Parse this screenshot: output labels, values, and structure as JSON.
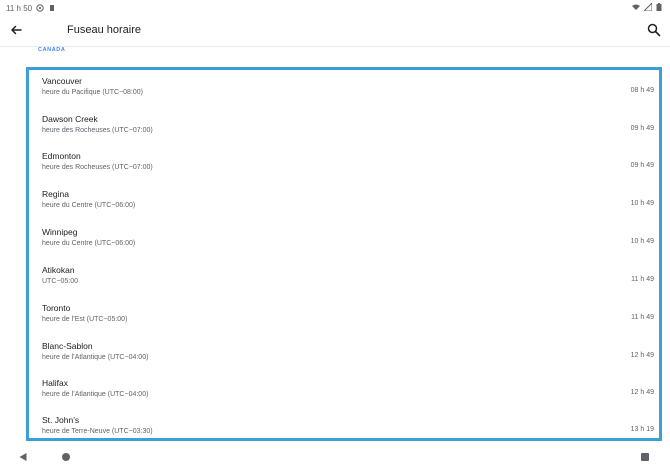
{
  "status": {
    "time": "11 h 50"
  },
  "appbar": {
    "title": "Fuseau horaire"
  },
  "section": "CANADA",
  "rows": [
    {
      "city": "Vancouver",
      "zone": "heure du Pacifique (UTC−08:00)",
      "time": "08 h 49"
    },
    {
      "city": "Dawson Creek",
      "zone": "heure des Rocheuses (UTC−07:00)",
      "time": "09 h 49"
    },
    {
      "city": "Edmonton",
      "zone": "heure des Rocheuses (UTC−07:00)",
      "time": "09 h 49"
    },
    {
      "city": "Regina",
      "zone": "heure du Centre (UTC−06:00)",
      "time": "10 h 49"
    },
    {
      "city": "Winnipeg",
      "zone": "heure du Centre (UTC−06:00)",
      "time": "10 h 49"
    },
    {
      "city": "Atikokan",
      "zone": "UTC−05:00",
      "time": "11 h 49"
    },
    {
      "city": "Toronto",
      "zone": "heure de l’Est (UTC−05:00)",
      "time": "11 h 49"
    },
    {
      "city": "Blanc-Sablon",
      "zone": "heure de l’Atlantique (UTC−04:00)",
      "time": "12 h 49"
    },
    {
      "city": "Halifax",
      "zone": "heure de l’Atlantique (UTC−04:00)",
      "time": "12 h 49"
    },
    {
      "city": "St. John’s",
      "zone": "heure de Terre-Neuve (UTC−03:30)",
      "time": "13 h 19"
    }
  ],
  "colors": {
    "accent": "#4285f4",
    "highlight_border": "#3aa0d8"
  }
}
